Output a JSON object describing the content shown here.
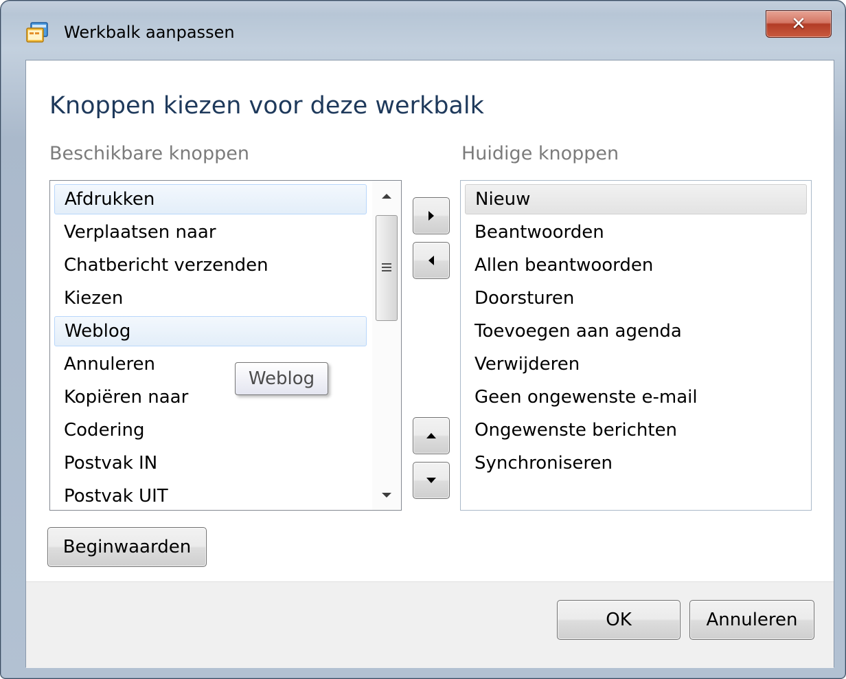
{
  "window": {
    "title": "Werkbalk aanpassen",
    "icon": "toolbar-window-icon",
    "close_icon": "close-icon"
  },
  "main": {
    "heading": "Knoppen kiezen voor deze werkbalk",
    "available_label": "Beschikbare knoppen",
    "current_label": "Huidige knoppen"
  },
  "available": [
    "Afdrukken",
    "Verplaatsen naar",
    "Chatbericht verzenden",
    "Kiezen",
    "Weblog",
    "Annuleren",
    "Kopiëren naar",
    "Codering",
    "Postvak IN",
    "Postvak UIT"
  ],
  "current": [
    "Nieuw",
    "Beantwoorden",
    "Allen beantwoorden",
    "Doorsturen",
    "Toevoegen aan agenda",
    "Verwijderen",
    "Geen ongewenste e-mail",
    "Ongewenste berichten",
    "Synchroniseren"
  ],
  "tooltip": "Weblog",
  "buttons": {
    "reset": "Beginwaarden",
    "ok": "OK",
    "cancel": "Annuleren"
  },
  "colors": {
    "heading": "#1e395b",
    "label": "#7b7b7b",
    "close_button": "#c95a3f",
    "hover_border": "#b8d6fb"
  }
}
